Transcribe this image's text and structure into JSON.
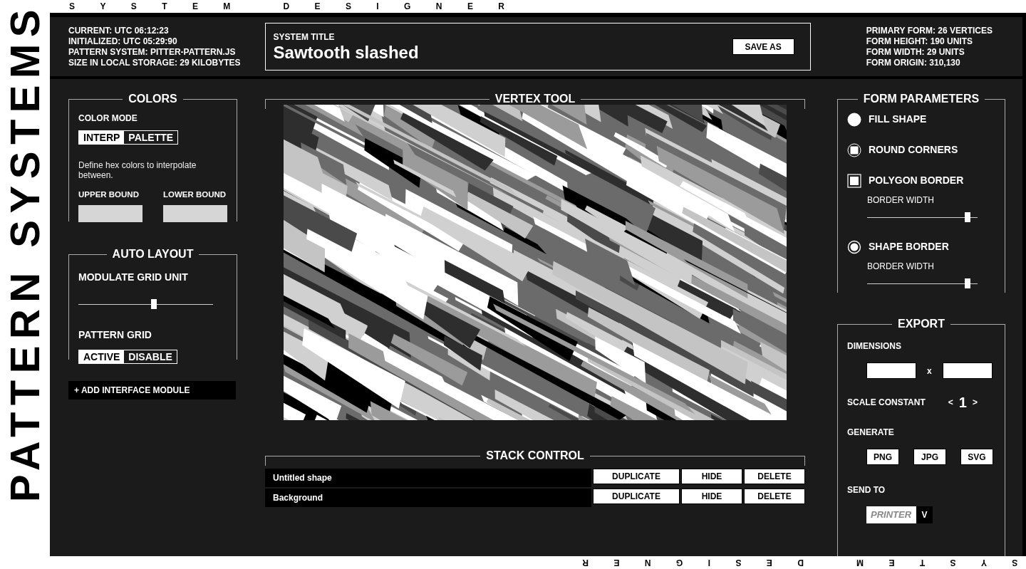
{
  "side_title": "PATTERN SYSTEMS",
  "top_banner": "SYSTEM DESIGNER",
  "bottom_banner": "SYSTEM DESIGNER",
  "header": {
    "info": [
      "CURRENT: UTC 06:12:23",
      "INITIALIZED: UTC 05:29:90",
      "PATTERN SYSTEM: PITTER-PATTERN.JS",
      "SIZE IN LOCAL STORAGE: 29 KILOBYTES"
    ],
    "system_title": {
      "label": "SYSTEM TITLE",
      "value": "Sawtooth slashed",
      "button": "SAVE AS"
    },
    "form_info": [
      "PRIMARY FORM: 26 VERTICES",
      "FORM HEIGHT: 190 UNITS",
      "FORM WIDTH: 29 UNITS",
      "FORM ORIGIN: 310,130"
    ]
  },
  "colors": {
    "title": "COLORS",
    "mode_label": "COLOR MODE",
    "modes": [
      {
        "label": "INTERP",
        "selected": true
      },
      {
        "label": "PALETTE",
        "selected": false
      }
    ],
    "description": "Define hex colors to interpolate between.",
    "bounds": [
      {
        "label": "UPPER BOUND"
      },
      {
        "label": "LOWER BOUND"
      }
    ]
  },
  "auto_layout": {
    "title": "AUTO LAYOUT",
    "slider": {
      "label": "MODULATE GRID UNIT",
      "level": 0.56
    },
    "grid_label": "PATTERN GRID",
    "grid_options": [
      {
        "label": "ACTIVE",
        "selected": true
      },
      {
        "label": "DISABLE",
        "selected": false
      }
    ]
  },
  "add_module": "+ ADD INTERFACE MODULE",
  "vertex_tool": {
    "title": "VERTEX TOOL"
  },
  "stack_control": {
    "title": "STACK CONTROL",
    "layers": [
      {
        "name": "Untitled shape",
        "actions": [
          "DUPLICATE",
          "HIDE",
          "DELETE"
        ]
      },
      {
        "name": "Background",
        "actions": [
          "DUPLICATE",
          "HIDE",
          "DELETE"
        ]
      }
    ]
  },
  "form_parameters": {
    "title": "FORM PARAMETERS",
    "options": [
      {
        "kind": "dot",
        "label": "FILL SHAPE",
        "checked": true
      },
      {
        "kind": "ring-square",
        "label": "ROUND CORNERS",
        "checked": true
      },
      {
        "kind": "square",
        "label": "POLYGON BORDER",
        "checked": true,
        "slider": {
          "label": "BORDER WIDTH",
          "level": 0.91
        }
      },
      {
        "kind": "ring",
        "label": "SHAPE BORDER",
        "checked": true,
        "slider": {
          "label": "BORDER WIDTH",
          "level": 0.91
        }
      }
    ]
  },
  "export": {
    "title": "EXPORT",
    "dimensions_label": "DIMENSIONS",
    "times": "x",
    "scale_label": "SCALE CONSTANT",
    "scale_prev": "<",
    "scale_value": "1",
    "scale_next": ">",
    "generate_label": "GENERATE",
    "formats": [
      "PNG",
      "JPG",
      "SVG"
    ],
    "send_label": "SEND TO",
    "send_placeholder": "PRINTER",
    "send_toggle": "V"
  }
}
